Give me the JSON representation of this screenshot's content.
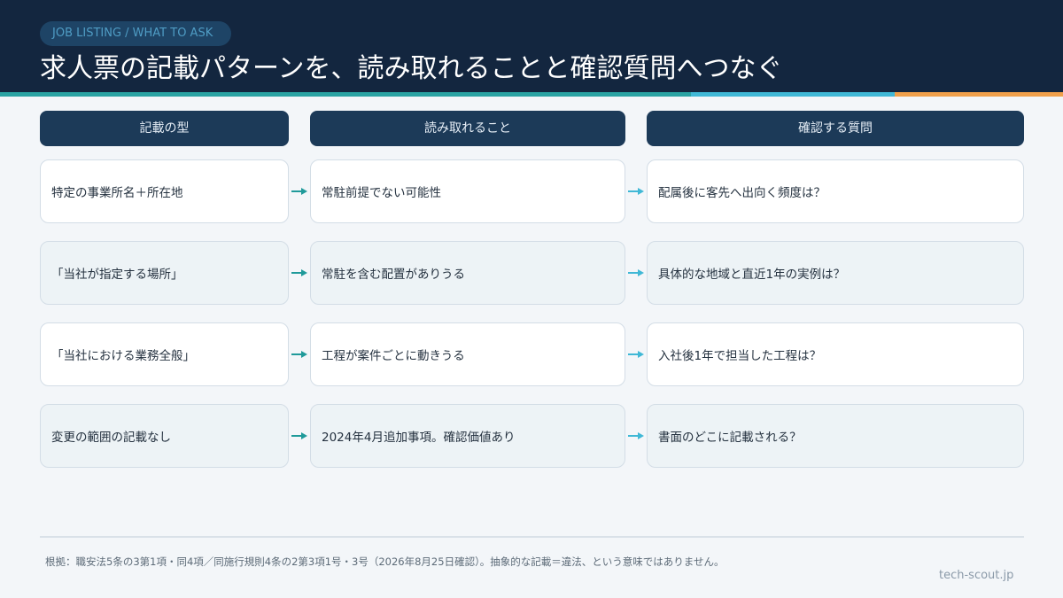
{
  "header": {
    "tag": "JOB LISTING / WHAT TO ASK",
    "title": "求人票の記載パターンを、読み取れることと確認質問へつなぐ"
  },
  "colors": {
    "header_bg": "#13263f",
    "accent_teal": "#2aa3a3",
    "accent_cyan": "#40b8d6",
    "accent_orange": "#f0a04b",
    "column_header_bg": "#1c3a58"
  },
  "columns": [
    "記載の型",
    "読み取れること",
    "確認する質問"
  ],
  "rows": [
    {
      "pattern": "特定の事業所名＋所在地",
      "reading": "常駐前提でない可能性",
      "question": "配属後に客先へ出向く頻度は？"
    },
    {
      "pattern": "「当社が指定する場所」",
      "reading": "常駐を含む配置がありうる",
      "question": "具体的な地域と直近1年の実例は？"
    },
    {
      "pattern": "「当社における業務全般」",
      "reading": "工程が案件ごとに動きうる",
      "question": "入社後1年で担当した工程は？"
    },
    {
      "pattern": "変更の範囲の記載なし",
      "reading": "2024年4月追加事項。確認価値あり",
      "question": "書面のどこに記載される？"
    }
  ],
  "arrow_icons": [
    "arrow-right-icon"
  ],
  "footer": {
    "note": "根拠：職安法5条の3第1項・同4項／同施行規則4条の2第3項1号・3号（2026年8月25日確認）。抽象的な記載＝違法、という意味ではありません。",
    "site": "tech-scout.jp"
  }
}
